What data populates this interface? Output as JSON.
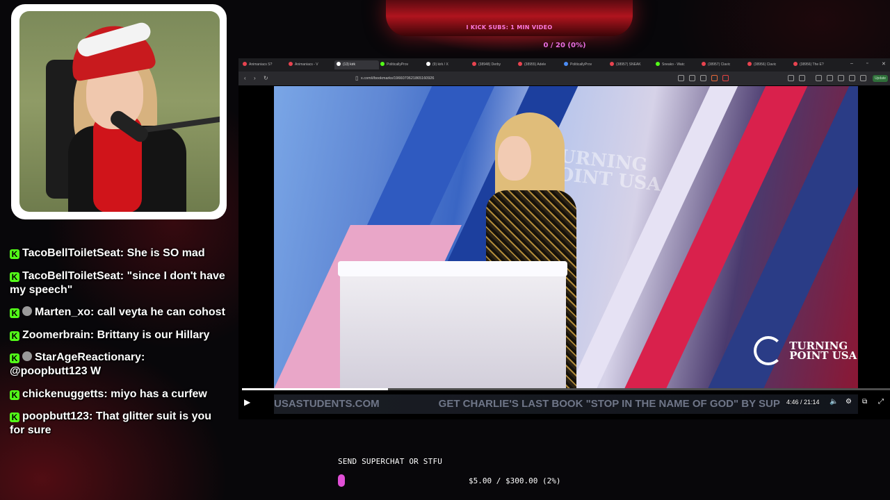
{
  "overlay": {
    "top_banner": "I KICK SUBS: 1 MIN VIDEO",
    "counter": "0 / 20 (0%)"
  },
  "browser": {
    "tabs": [
      {
        "label": "Animaniacs S?",
        "color": "#e8434f",
        "active": false
      },
      {
        "label": "Animaniacs - V",
        "color": "#e8434f",
        "active": false
      },
      {
        "label": "(13) kirk",
        "color": "#ffffff",
        "active": true
      },
      {
        "label": "PoliticallyProv",
        "color": "#53fc18",
        "active": false
      },
      {
        "label": "(9) kirk / X",
        "color": "#ffffff",
        "active": false
      },
      {
        "label": "(38948) Derby",
        "color": "#e8434f",
        "active": false
      },
      {
        "label": "(38955) Adele",
        "color": "#e8434f",
        "active": false
      },
      {
        "label": "PoliticallyProv",
        "color": "#4c8df6",
        "active": false
      },
      {
        "label": "(38957) SNEAK",
        "color": "#e8434f",
        "active": false
      },
      {
        "label": "Sneako - Watc",
        "color": "#53fc18",
        "active": false
      },
      {
        "label": "(38957) Clavic",
        "color": "#e8434f",
        "active": false
      },
      {
        "label": "(38956) Clavic",
        "color": "#e8434f",
        "active": false
      },
      {
        "label": "(38956) The E?",
        "color": "#e8434f",
        "active": false
      }
    ],
    "url": "x.com/i/bookmarks/1966070621865160926",
    "update_label": "Update"
  },
  "video": {
    "stage_text_line1": "TURNING",
    "stage_text_line2": "POINT USA",
    "logo_line1": "TURNING",
    "logo_line2": "POINT USA",
    "ticker_items": [
      "USASTUDENTS.COM",
      "GET CHARLIE'S LAST BOOK \"STOP IN THE NAME OF GOD\" BY SUP"
    ],
    "time": "4:46 / 21:14",
    "progress": 0.225,
    "icons": [
      "play-icon",
      "volume-icon",
      "settings-icon",
      "pip-icon",
      "fullscreen-icon"
    ]
  },
  "chat": [
    {
      "user": "TacoBellToiletSeat",
      "message": "She is SO mad",
      "badge": "kick",
      "avatar": false
    },
    {
      "user": "TacoBellToiletSeat",
      "message": "\"since I don't have my speech\"",
      "badge": "kick",
      "avatar": false
    },
    {
      "user": "Marten_xo",
      "message": "call veyta he can cohost",
      "badge": "kick",
      "avatar": true
    },
    {
      "user": "Zoomerbrain",
      "message": "Brittany is our Hillary",
      "badge": "kick",
      "avatar": false
    },
    {
      "user": "StarAgeReactionary",
      "message": "@poopbutt123 W",
      "badge": "kick",
      "avatar": true
    },
    {
      "user": "chickenuggetts",
      "message": "miyo has a curfew",
      "badge": "kick",
      "avatar": false
    },
    {
      "user": "poopbutt123",
      "message": "That glitter suit is you for sure",
      "badge": "kick",
      "avatar": false
    }
  ],
  "superchat": {
    "label": "SEND SUPERCHAT OR STFU",
    "amount": "$5.00 / $300.00 (2%)",
    "fraction": 0.02,
    "color": "#e04fd6"
  }
}
